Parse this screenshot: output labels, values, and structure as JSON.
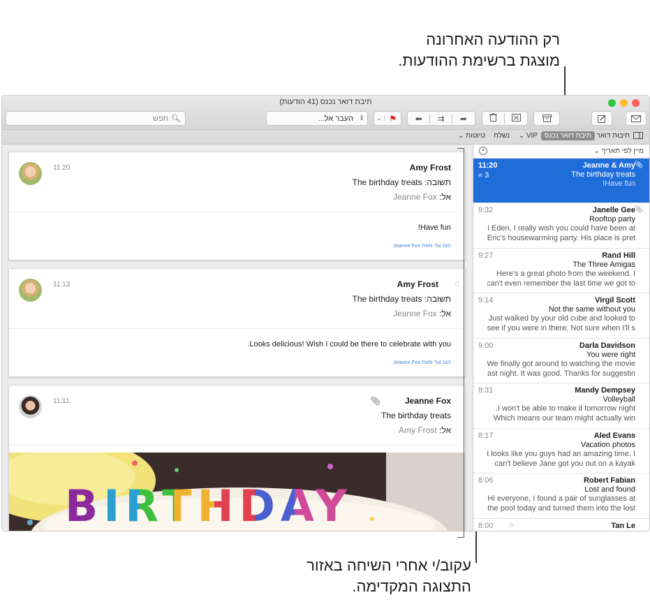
{
  "callouts": {
    "top": [
      "רק ההודעה האחרונה",
      "מוצגת ברשימת ההודעות."
    ],
    "bottom": [
      "עקוב/י אחרי השיחה באזור",
      "התצוגה המקדימה."
    ]
  },
  "window": {
    "title": "תיבת דואר נכנס (41 הודעות)",
    "search_placeholder": "חפש",
    "move_to_label": "העבר אל...",
    "favorites": {
      "mailboxes": "תיבות דואר",
      "inbox": "תיבת דואר נכנס",
      "vip": "VIP",
      "sent": "נשלח",
      "drafts": "טיוטות"
    },
    "sort_label": "מיין לפי תאריך",
    "colors": {
      "selection": "#1f6dd9",
      "link": "#3a83d8",
      "flag": "#e02020"
    }
  },
  "messages": [
    {
      "sender": "Jeanne & Amy",
      "time": "11:20",
      "subject": "The birthday treats",
      "preview": [
        "Have fun!"
      ],
      "count": "3"
    },
    {
      "sender": "Janelle Gee",
      "time": "9:32",
      "subject": "Rooftop party",
      "preview": [
        "Hi Eden, I really wish you could have been at",
        "Eric's housewarming party. His place is pret..."
      ]
    },
    {
      "sender": "Rand Hill",
      "time": "9:27",
      "subject": "The Three Amigas",
      "preview": [
        "Here's a great photo from the weekend. I",
        "can't even remember the last time we got to..."
      ]
    },
    {
      "sender": "Virgil Scott",
      "time": "9:14",
      "subject": "Not the same without you",
      "preview": [
        "Just walked by your old cube and looked to",
        "see if you were in there. Not sure when I'll s..."
      ]
    },
    {
      "sender": "Darla Davidson",
      "time": "9:00",
      "subject": "You were right",
      "preview": [
        "We finally got around to watching the movie",
        "last night. It was good. Thanks for suggestin..."
      ]
    },
    {
      "sender": "Mandy Dempsey",
      "time": "8:31",
      "subject": "Volleyball",
      "preview": [
        "I won't be able to make it tomorrow night.",
        "Which means our team might actually win"
      ]
    },
    {
      "sender": "Aled Evans",
      "time": "8:17",
      "subject": "Vacation photos",
      "preview": [
        "It looks like you guys had an amazing time. I",
        "can't believe Jane got you out on a kayak"
      ]
    },
    {
      "sender": "Robert Fabian",
      "time": "8:06",
      "subject": "Lost and found",
      "preview": [
        "Hi everyone, I found a pair of sunglasses at",
        "the pool today and turned them into the lost..."
      ]
    },
    {
      "sender": "Tan Le",
      "time": "8:00",
      "subject": "",
      "preview": []
    }
  ],
  "conversation": [
    {
      "from": "Amy Frost",
      "time": "11:20",
      "subject": "תשובה: The birthday treats",
      "to_label": "אל:",
      "to": "Jeanne Fox",
      "body": "Have fun!",
      "more": "הצג עוד מאת Jeanne Fox"
    },
    {
      "from": "Amy Frost",
      "time": "11:13",
      "subject": "תשובה: The birthday treats",
      "to_label": "אל:",
      "to": "Jeanne Fox",
      "body": "Looks delicious! Wish I could be there to celebrate with you.",
      "more": "הצג עוד מאת Jeanne Fox"
    },
    {
      "from": "Jeanne Fox",
      "time": "11:11",
      "subject": "The birthday treats",
      "to_label": "אל:",
      "to": "Amy Frost",
      "image_text": "BIRTHDAY"
    }
  ]
}
